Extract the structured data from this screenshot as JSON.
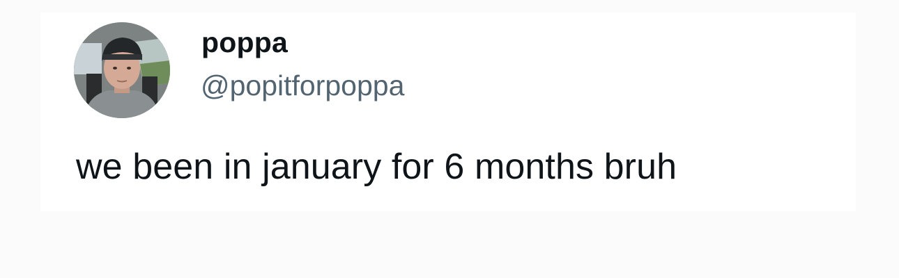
{
  "tweet": {
    "author": {
      "display_name": "poppa",
      "handle": "@popitforpoppa",
      "avatar_icon": "profile-photo"
    },
    "text": "we been in january for 6 months bruh"
  },
  "colors": {
    "text_primary": "#0f1419",
    "text_secondary": "#536471",
    "background": "#ffffff"
  }
}
